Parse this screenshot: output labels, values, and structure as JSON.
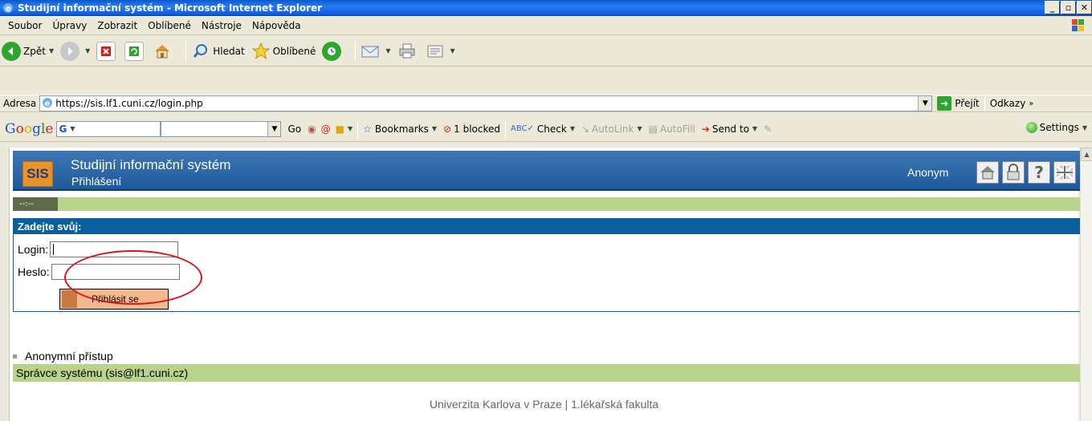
{
  "window": {
    "title": "Studijní informační systém - Microsoft Internet Explorer"
  },
  "menu": [
    "Soubor",
    "Úpravy",
    "Zobrazit",
    "Oblíbené",
    "Nástroje",
    "Nápověda"
  ],
  "toolbar": {
    "back": "Zpět",
    "search": "Hledat",
    "favorites": "Oblíbené"
  },
  "address": {
    "label": "Adresa",
    "url": "https://sis.lf1.cuni.cz/login.php",
    "go": "Přejít",
    "links": "Odkazy"
  },
  "google": {
    "go": "Go",
    "bookmarks": "Bookmarks",
    "blocked": "1 blocked",
    "check": "Check",
    "autolink": "AutoLink",
    "autofill": "AutoFill",
    "sendto": "Send to",
    "settings": "Settings"
  },
  "page": {
    "logo": "SIS",
    "title": "Studijní informační systém",
    "subtitle": "Přihlášení",
    "user": "Anonym",
    "nav_dash": "--:--",
    "login_header": "Zadejte svůj:",
    "login_label": "Login:",
    "password_label": "Heslo:",
    "submit": "Přihlásit se",
    "anon_link": "Anonymní přístup",
    "admin": "Správce systému (sis@lf1.cuni.cz)",
    "footer": "Univerzita Karlova v Praze | 1.lékařská fakulta"
  },
  "colors": {
    "accent": "#0a5f9e",
    "green_bar": "#b8d38a",
    "annotation": "#d8141a"
  }
}
